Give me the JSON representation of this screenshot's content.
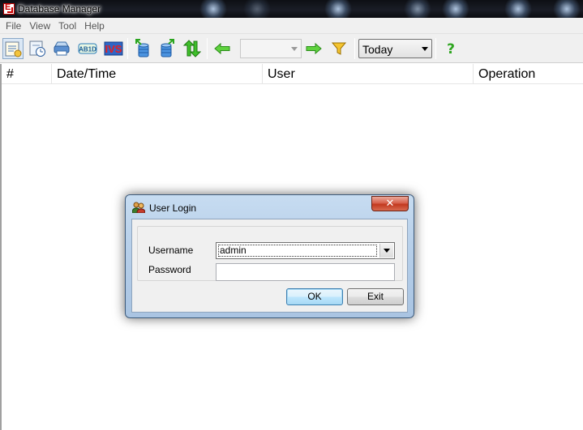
{
  "window": {
    "title": "Database Manager"
  },
  "menu": {
    "items": [
      "File",
      "View",
      "Tool",
      "Help"
    ]
  },
  "toolbar": {
    "buttons": [
      "record-list-icon",
      "schedule-clock-icon",
      "printer-icon",
      "ab-text-icon",
      "ivs-icon",
      "database-export-icon",
      "database-import-icon",
      "sync-arrows-icon"
    ],
    "nav_prev": "arrow-left-icon",
    "range_combo_value": "",
    "nav_next": "arrow-right-icon",
    "filter": "filter-icon",
    "period_value": "Today",
    "help": "help-question-icon"
  },
  "table": {
    "columns": [
      "#",
      "Date/Time",
      "User",
      "Operation"
    ]
  },
  "login_dialog": {
    "title": "User Login",
    "username_label": "Username",
    "username_value": "admin",
    "password_label": "Password",
    "password_value": "",
    "ok_label": "OK",
    "exit_label": "Exit",
    "close_glyph": "✕"
  }
}
